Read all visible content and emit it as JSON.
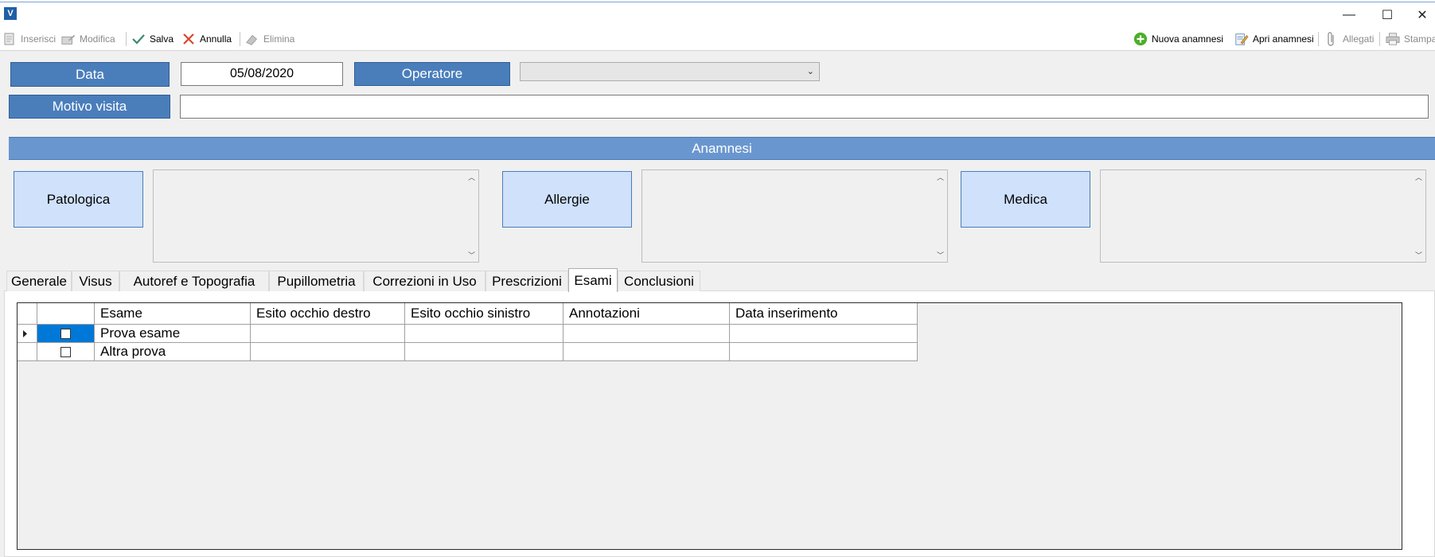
{
  "window": {
    "app_icon": "V",
    "controls": {
      "minimize": "—",
      "maximize": "☐",
      "close": "✕"
    }
  },
  "toolbar": {
    "left": [
      {
        "label": "Inserisci",
        "icon": "insert-icon",
        "disabled": true
      },
      {
        "label": "Modifica",
        "icon": "edit-icon",
        "disabled": true
      },
      {
        "label": "Salva",
        "icon": "check-icon",
        "disabled": false
      },
      {
        "label": "Annulla",
        "icon": "cancel-icon",
        "disabled": false
      },
      {
        "label": "Elimina",
        "icon": "eraser-icon",
        "disabled": true
      }
    ],
    "right": [
      {
        "label": "Nuova anamnesi",
        "icon": "plus-circle-icon",
        "disabled": false
      },
      {
        "label": "Apri anamnesi",
        "icon": "document-edit-icon",
        "disabled": false
      },
      {
        "label": "Allegati",
        "icon": "paperclip-icon",
        "disabled": true
      },
      {
        "label": "Stampa",
        "icon": "printer-icon",
        "disabled": true
      }
    ]
  },
  "form": {
    "data_label": "Data",
    "data_value": "05/08/2020",
    "operatore_label": "Operatore",
    "operatore_value": "",
    "motivo_label": "Motivo visita",
    "motivo_value": ""
  },
  "anamnesi": {
    "title": "Anamnesi",
    "sections": [
      {
        "label": "Patologica",
        "value": ""
      },
      {
        "label": "Allergie",
        "value": ""
      },
      {
        "label": "Medica",
        "value": ""
      }
    ]
  },
  "tabs": [
    {
      "label": "Generale"
    },
    {
      "label": "Visus"
    },
    {
      "label": "Autoref e Topografia"
    },
    {
      "label": "Pupillometria"
    },
    {
      "label": "Correzioni in Uso"
    },
    {
      "label": "Prescrizioni"
    },
    {
      "label": "Esami",
      "active": true
    },
    {
      "label": "Conclusioni"
    }
  ],
  "grid": {
    "columns": [
      "",
      "Esame",
      "Esito occhio destro",
      "Esito occhio sinistro",
      "Annotazioni",
      "Data inserimento"
    ],
    "rows": [
      {
        "checked": false,
        "selected": true,
        "esame": "Prova esame",
        "destro": "",
        "sinistro": "",
        "annotazioni": "",
        "data": ""
      },
      {
        "checked": false,
        "selected": false,
        "esame": "Altra prova",
        "destro": "",
        "sinistro": "",
        "annotazioni": "",
        "data": ""
      }
    ]
  },
  "colors": {
    "label_blue": "#4a7ebb",
    "section_bar": "#6a96d0",
    "anamnesi_button": "#cfe1fb",
    "selection": "#0078d7"
  }
}
